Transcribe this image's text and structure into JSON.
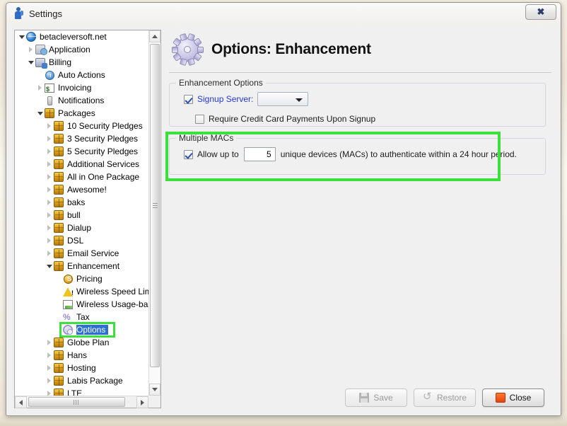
{
  "window": {
    "title": "Settings",
    "app_icon": "person-icon",
    "close_button_label": "✖"
  },
  "tree": {
    "name": "settings-tree",
    "nodes": [
      {
        "label": "betacleversoft.net",
        "depth": 0,
        "icon": "globe-icon",
        "expander": "open",
        "selected": false
      },
      {
        "label": "Application",
        "depth": 1,
        "icon": "app-icon",
        "expander": "closed",
        "selected": false
      },
      {
        "label": "Billing",
        "depth": 1,
        "icon": "billing-icon",
        "expander": "open",
        "selected": false
      },
      {
        "label": "Auto Actions",
        "depth": 2,
        "icon": "clock-icon",
        "expander": "none",
        "selected": false
      },
      {
        "label": "Invoicing",
        "depth": 2,
        "icon": "invoice-icon",
        "expander": "closed",
        "selected": false
      },
      {
        "label": "Notifications",
        "depth": 2,
        "icon": "bell-icon",
        "expander": "none",
        "selected": false
      },
      {
        "label": "Packages",
        "depth": 2,
        "icon": "package-icon",
        "expander": "open",
        "selected": false
      },
      {
        "label": "10 Security Pledges",
        "depth": 3,
        "icon": "package-icon",
        "expander": "closed",
        "selected": false
      },
      {
        "label": "3 Security Pledges",
        "depth": 3,
        "icon": "package-icon",
        "expander": "closed",
        "selected": false
      },
      {
        "label": "5 Security Pledges",
        "depth": 3,
        "icon": "package-icon",
        "expander": "closed",
        "selected": false
      },
      {
        "label": "Additional Services",
        "depth": 3,
        "icon": "package-icon",
        "expander": "closed",
        "selected": false
      },
      {
        "label": "All in One Package",
        "depth": 3,
        "icon": "package-icon",
        "expander": "closed",
        "selected": false
      },
      {
        "label": "Awesome!",
        "depth": 3,
        "icon": "package-icon",
        "expander": "closed",
        "selected": false
      },
      {
        "label": "baks",
        "depth": 3,
        "icon": "package-icon",
        "expander": "closed",
        "selected": false
      },
      {
        "label": "bull",
        "depth": 3,
        "icon": "package-icon",
        "expander": "closed",
        "selected": false
      },
      {
        "label": "Dialup",
        "depth": 3,
        "icon": "package-icon",
        "expander": "closed",
        "selected": false
      },
      {
        "label": "DSL",
        "depth": 3,
        "icon": "package-icon",
        "expander": "closed",
        "selected": false
      },
      {
        "label": "Email Service",
        "depth": 3,
        "icon": "package-icon",
        "expander": "closed",
        "selected": false
      },
      {
        "label": "Enhancement",
        "depth": 3,
        "icon": "package-icon",
        "expander": "open",
        "selected": false
      },
      {
        "label": "Pricing",
        "depth": 4,
        "icon": "coin-icon",
        "expander": "none",
        "selected": false
      },
      {
        "label": "Wireless Speed Limits",
        "depth": 4,
        "icon": "warning-icon",
        "expander": "none",
        "selected": false
      },
      {
        "label": "Wireless Usage-based",
        "depth": 4,
        "icon": "chart-icon",
        "expander": "none",
        "selected": false
      },
      {
        "label": "Tax",
        "depth": 4,
        "icon": "percent-icon",
        "expander": "none",
        "selected": false
      },
      {
        "label": "Options",
        "depth": 4,
        "icon": "gear-icon",
        "expander": "none",
        "selected": true
      },
      {
        "label": "Globe Plan",
        "depth": 3,
        "icon": "package-icon",
        "expander": "closed",
        "selected": false
      },
      {
        "label": "Hans",
        "depth": 3,
        "icon": "package-icon",
        "expander": "closed",
        "selected": false
      },
      {
        "label": "Hosting",
        "depth": 3,
        "icon": "package-icon",
        "expander": "closed",
        "selected": false
      },
      {
        "label": "Labis Package",
        "depth": 3,
        "icon": "package-icon",
        "expander": "closed",
        "selected": false
      },
      {
        "label": "LTE",
        "depth": 3,
        "icon": "package-icon",
        "expander": "closed",
        "selected": false
      }
    ]
  },
  "page": {
    "title": "Options: Enhancement",
    "title_icon": "gear-icon"
  },
  "enhancement_options": {
    "legend": "Enhancement Options",
    "signup_server": {
      "label": "Signup Server:",
      "checked": true,
      "dropdown_value": "",
      "dropdown_placeholder": ""
    },
    "require_cc": {
      "label": "Require Credit Card Payments Upon Signup",
      "checked": false
    }
  },
  "multiple_macs": {
    "legend": "Multiple MACs",
    "checked": true,
    "prefix_label": "Allow up to",
    "count_value": "5",
    "suffix_label": "unique devices (MACs) to authenticate within a 24 hour period."
  },
  "footer": {
    "save_label": "Save",
    "restore_label": "Restore",
    "close_label": "Close"
  },
  "annotations": {
    "highlight_color": "#3ce03c"
  }
}
